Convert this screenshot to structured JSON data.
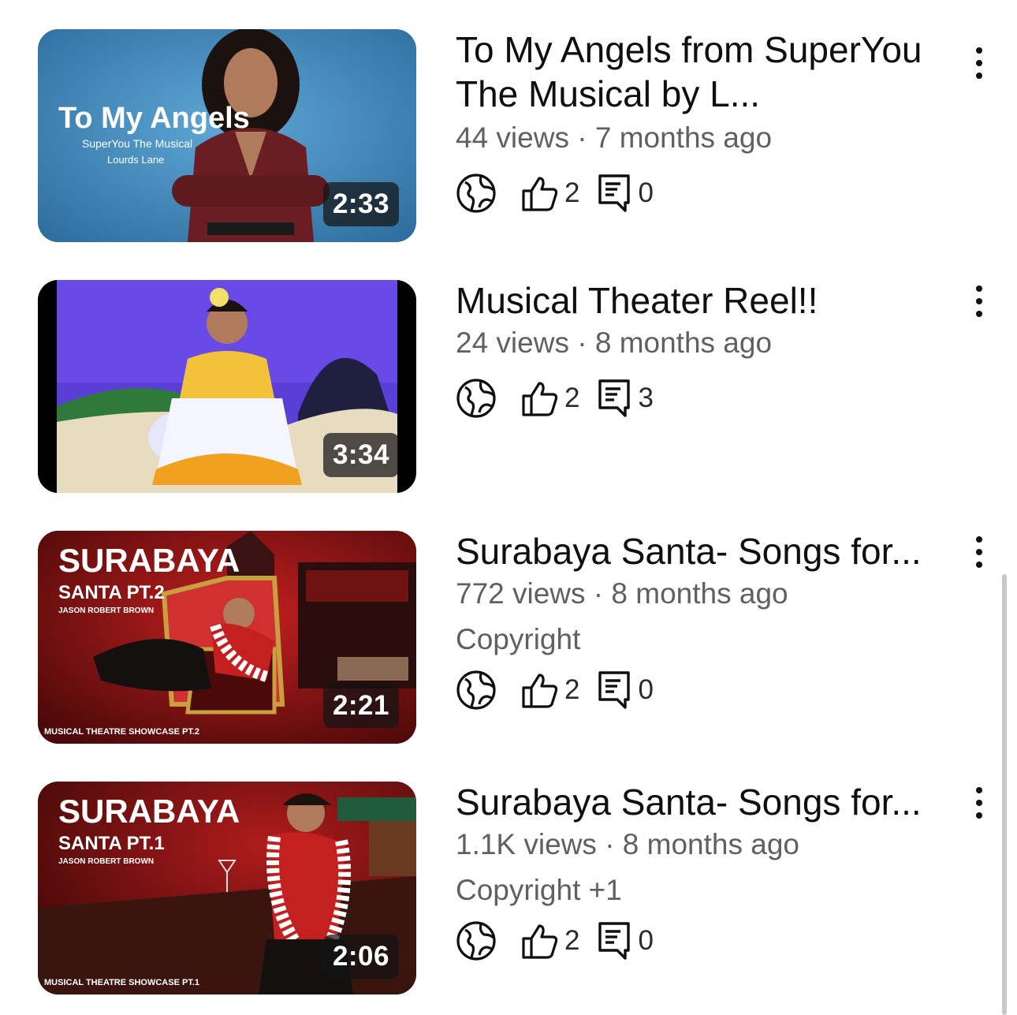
{
  "videos": [
    {
      "title": "To My Angels from SuperYou The Musical by L...",
      "meta": "44 views · 7 months ago",
      "extra": "",
      "duration": "2:33",
      "likes": "2",
      "comments": "0",
      "thumb_text": {
        "main": "To My Angels",
        "sub1": "SuperYou The Musical",
        "sub2": "Lourds Lane"
      }
    },
    {
      "title": "Musical Theater Reel!!",
      "meta": "24 views · 8 months ago",
      "extra": "",
      "duration": "3:34",
      "likes": "2",
      "comments": "3"
    },
    {
      "title": "Surabaya Santa- Songs for...",
      "meta": "772 views · 8 months ago",
      "extra": "Copyright",
      "duration": "2:21",
      "likes": "2",
      "comments": "0",
      "thumb_text": {
        "main": "SURABAYA",
        "sub1": "SANTA PT.2",
        "sub2": "JASON ROBERT BROWN",
        "footer": "MUSICAL THEATRE SHOWCASE PT.2"
      }
    },
    {
      "title": "Surabaya Santa- Songs for...",
      "meta": "1.1K views · 8 months ago",
      "extra": "Copyright +1",
      "duration": "2:06",
      "likes": "2",
      "comments": "0",
      "thumb_text": {
        "main": "SURABAYA",
        "sub1": "SANTA PT.1",
        "sub2": "JASON ROBERT BROWN",
        "footer": "MUSICAL THEATRE SHOWCASE PT.1"
      }
    }
  ],
  "icons": {
    "visibility": "globe-icon",
    "likes": "thumbs-up-icon",
    "comments": "comment-icon",
    "more": "more-vertical-icon"
  }
}
